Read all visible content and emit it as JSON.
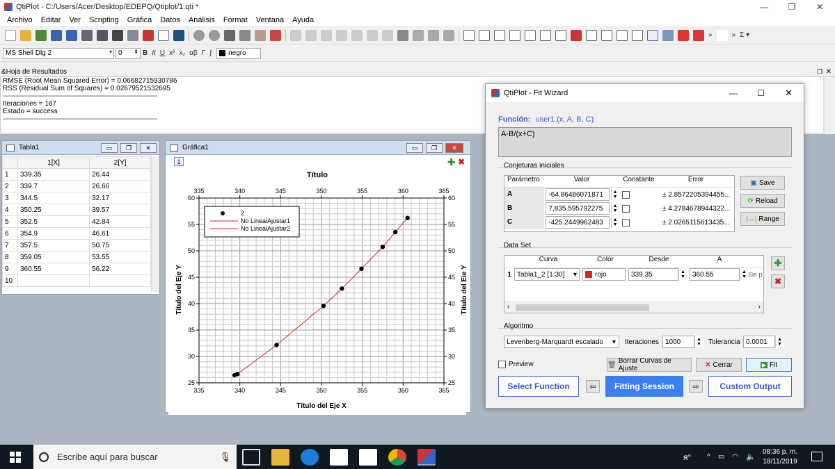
{
  "window": {
    "title": "QtiPlot - C:/Users/Acer/Desktop/EDEPQ/Qtiplot/1.qti *",
    "min": "—",
    "max": "❐",
    "close": "✕"
  },
  "menu": [
    "Archivo",
    "Editar",
    "Ver",
    "Scripting",
    "Gráfica",
    "Datos",
    "Análisis",
    "Format",
    "Ventana",
    "Ayuda"
  ],
  "format_toolbar": {
    "font": "MS Shell Dlg 2",
    "size": "0",
    "bold": "B",
    "italic": "It",
    "underline": "U",
    "sup": "x²",
    "sub": "x₂",
    "greek": "αβ",
    "gamma": "Γ",
    "integral": "∫",
    "color": "negro"
  },
  "results": {
    "header": "&Hoja de Resultados",
    "lines": [
      "RMSE (Root Mean Squared Error) = 0.06682715930786",
      "RSS (Residual Sum of Squares) = 0.02679521532695",
      "-----------------------------------------------------------------------------------------------",
      "Iteraciones = 167",
      "Estado = success",
      "-----------------------------------------------------------------------------------------------"
    ]
  },
  "table": {
    "title": "Tabla1",
    "columns": [
      "",
      "1[X]",
      "2[Y]"
    ],
    "rows": [
      [
        "1",
        "339.35",
        "26.44"
      ],
      [
        "2",
        "339.7",
        "26.66"
      ],
      [
        "3",
        "344.5",
        "32.17"
      ],
      [
        "4",
        "350.25",
        "39.57"
      ],
      [
        "5",
        "352.5",
        "42.84"
      ],
      [
        "6",
        "354.9",
        "46.61"
      ],
      [
        "7",
        "357.5",
        "50.75"
      ],
      [
        "8",
        "359.05",
        "53.55"
      ],
      [
        "9",
        "360.55",
        "56.22"
      ],
      [
        "10",
        "",
        ""
      ]
    ]
  },
  "chart_window": {
    "title": "Gráfica1",
    "layer": "1"
  },
  "chart_data": {
    "type": "scatter",
    "title": "Título",
    "xlabel": "Título del Eje X",
    "ylabel": "Título del Eje Y",
    "xlim": [
      335,
      365
    ],
    "ylim": [
      25,
      60
    ],
    "xticks": [
      "335",
      "340",
      "345",
      "350",
      "355",
      "360",
      "365"
    ],
    "yticks": [
      "25",
      "30",
      "35",
      "40",
      "45",
      "50",
      "55",
      "60"
    ],
    "grid": true,
    "legend_position": "top-left",
    "legend": [
      "2",
      "No LinealAjustar1",
      "No LinealAjustar2"
    ],
    "points": {
      "x": [
        339.35,
        339.7,
        344.5,
        350.25,
        352.5,
        354.9,
        357.5,
        359.05,
        360.55
      ],
      "y": [
        26.44,
        26.66,
        32.17,
        39.57,
        42.84,
        46.61,
        50.75,
        53.55,
        56.22
      ]
    },
    "fit_color": "#e02020",
    "point_color": "#000000"
  },
  "wizard": {
    "title": "QtiPlot - Fit Wizard",
    "function_label": "Función:",
    "function_name": "user1 (x, A, B, C)",
    "formula": "A-B/(x+C)",
    "guesses_label": "Conjeturas iniciales",
    "param_headers": [
      "Parámetro",
      "Valor",
      "Constante",
      "Error"
    ],
    "params": [
      {
        "name": "A",
        "value": "-64.86486071871",
        "error": "± 2.8572205394455..."
      },
      {
        "name": "B",
        "value": "7,835.595792275",
        "error": "± 4.2784678944322..."
      },
      {
        "name": "C",
        "value": "-425.2449962483",
        "error": "± 2.0265115613435..."
      }
    ],
    "save": "Save",
    "reload": "Reload",
    "range": "Range",
    "dataset_label": "Data Set",
    "dataset_headers": [
      "Curva",
      "Color",
      "Desde",
      "A"
    ],
    "dataset_row": {
      "num": "1",
      "curve": "Tabla1_2 [1:30]",
      "color": "rojo",
      "from": "339.35",
      "to": "360.55",
      "extra": "Sin p"
    },
    "algorithm_label": "Algoritmo",
    "algorithm": "Levenberg-Marquardt escalado",
    "iter_label": "Iteraciones",
    "iter": "1000",
    "tol_label": "Tolerancia",
    "tol": "0.0001",
    "preview": "Preview",
    "clear": "Borrar Curvas de Ajuste",
    "cancel": "Cerrar",
    "fit": "Fit",
    "select_function": "Select Function",
    "fitting_session": "Fitting Session",
    "custom_output": "Custom Output"
  },
  "taskbar": {
    "search": "Escribe aquí para buscar",
    "time": "08:36 p. m.",
    "date": "18/11/2019"
  }
}
